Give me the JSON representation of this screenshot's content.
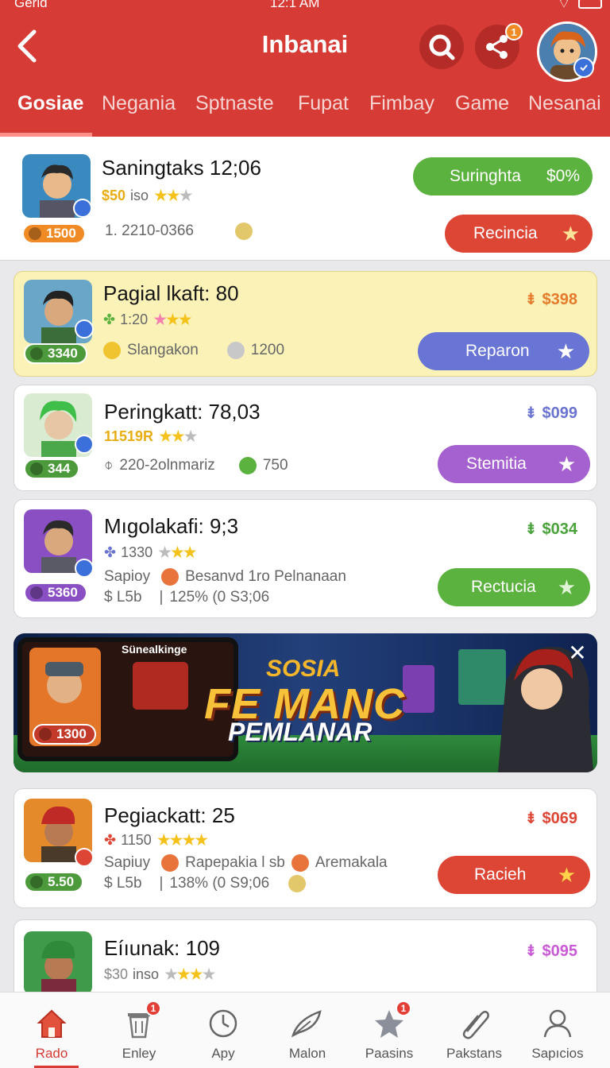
{
  "status_bar": {
    "carrier": "Gerid",
    "time": "12:1 AM"
  },
  "header": {
    "title": "Inbanai",
    "share_badge": "1"
  },
  "colors": {
    "brand": "#d63b35",
    "green": "#5cb23f",
    "red": "#dd4535",
    "indigo": "#6875d4",
    "purple": "#a461cf"
  },
  "tabs": [
    {
      "label": "Gosiae"
    },
    {
      "label": "Negania"
    },
    {
      "label": "Sptnaste"
    },
    {
      "label": "Fupat"
    },
    {
      "label": "Fimbay"
    },
    {
      "label": "Game"
    },
    {
      "label": "Nesanai"
    }
  ],
  "items": [
    {
      "title": "Saningtaks 12;06",
      "price": "$50",
      "meta": "iso",
      "score": "1500",
      "sub": "1. 2210-0366",
      "btn_top": "Suringhta",
      "btn_top_pct": "$0%",
      "button": "Recincia"
    },
    {
      "title": "Pagial lkaft: 80",
      "meta": "1:20",
      "score": "3340",
      "price_right": "$398",
      "sub_a": "Slangakon",
      "sub_b": "1200",
      "button": "Reparon"
    },
    {
      "title": "Peringkatt: 78,03",
      "meta": "11519R",
      "score": "344",
      "price_right": "$099",
      "sub": "220-2olnmariz",
      "sub_b": "750",
      "button": "Stemitia"
    },
    {
      "title": "Mıgolakafi: 9;3",
      "meta": "1330",
      "score": "5360",
      "price_right": "$034",
      "sub_l1": "Sapioy",
      "sub_l1b": "Besanvd 1ro Pelnanaan",
      "sub_l2": "$ L5b",
      "sub_l2b": "125% (0 S3;06",
      "button": "Rectucia"
    },
    {
      "title": "Pegiackatt: 25",
      "meta": "1150",
      "score": "5.50",
      "price_right": "$069",
      "sub_l1": "Sapiuy",
      "sub_l1b": "Rapepakia l sb",
      "sub_l1c": "Aremakala",
      "sub_l2": "$ L5b",
      "sub_l2b": "138% (0 S9;06",
      "button": "Racieh"
    },
    {
      "title": "Eíıunak: 109",
      "price": "$30",
      "meta": "inso",
      "price_right": "$095"
    }
  ],
  "banner": {
    "label": "Sünealkinge",
    "kicker": "SOSIA",
    "headline": "FE MANC",
    "subhead": "PEMLANAR",
    "score": "1300",
    "close_icon": "close-icon"
  },
  "bottom_nav": [
    {
      "label": "Rado",
      "icon": "home-icon",
      "badge": ""
    },
    {
      "label": "Enley",
      "icon": "trash-icon",
      "badge": "1"
    },
    {
      "label": "Apy",
      "icon": "clock-icon",
      "badge": ""
    },
    {
      "label": "Malon",
      "icon": "feather-icon",
      "badge": ""
    },
    {
      "label": "Paasins",
      "icon": "star-icon",
      "badge": "1"
    },
    {
      "label": "Pakstans",
      "icon": "paperclip-icon",
      "badge": ""
    },
    {
      "label": "Sapıcios",
      "icon": "user-icon",
      "badge": ""
    }
  ]
}
